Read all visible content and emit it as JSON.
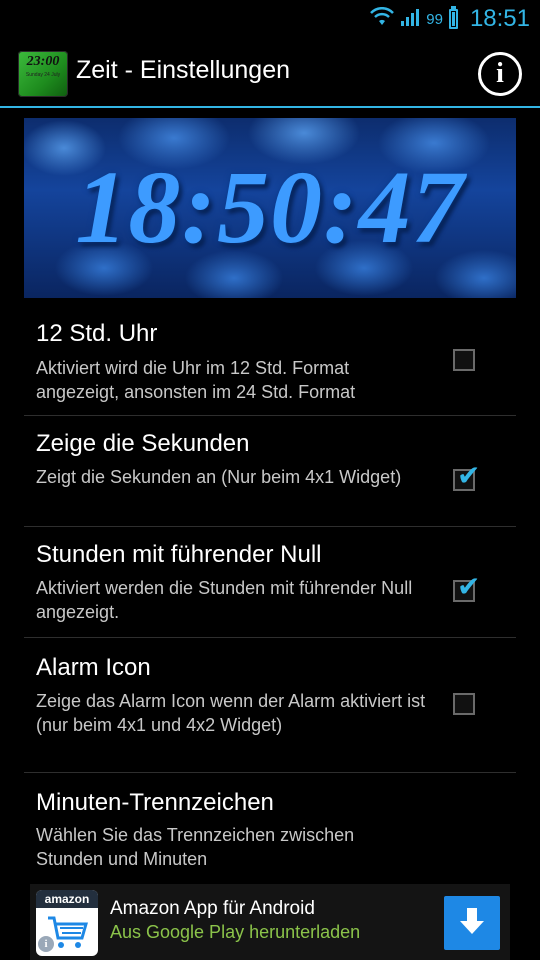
{
  "status_bar": {
    "battery_percent": "99",
    "time": "18:51"
  },
  "action_bar": {
    "title": "Zeit - Einstellungen",
    "app_icon_time": "23:00",
    "app_icon_date": "Sunday 24 July"
  },
  "preview": {
    "clock_time": "18:50:47"
  },
  "settings": [
    {
      "title": "12 Std. Uhr",
      "summary": "Aktiviert wird die Uhr im 12 Std. Format angezeigt, ansonsten im 24 Std. Format",
      "checked": false
    },
    {
      "title": "Zeige die Sekunden",
      "summary": "Zeigt die Sekunden an (Nur beim 4x1 Widget)",
      "checked": true
    },
    {
      "title": "Stunden mit führender Null",
      "summary": "Aktiviert werden die Stunden mit führender Null angezeigt.",
      "checked": true
    },
    {
      "title": "Alarm Icon",
      "summary": "Zeige das Alarm Icon wenn der Alarm aktiviert ist (nur beim 4x1 und 4x2 Widget)",
      "checked": false
    },
    {
      "title": "Minuten-Trennzeichen",
      "summary": "Wählen Sie das Trennzeichen zwischen Stunden und Minuten"
    }
  ],
  "ad": {
    "logo_text": "amazon",
    "title": "Amazon App für Android",
    "subtitle": "Aus Google Play herunterladen"
  },
  "colors": {
    "accent": "#33b5e5",
    "ad_subtitle": "#8bc34a",
    "download_button": "#1e88e5"
  }
}
